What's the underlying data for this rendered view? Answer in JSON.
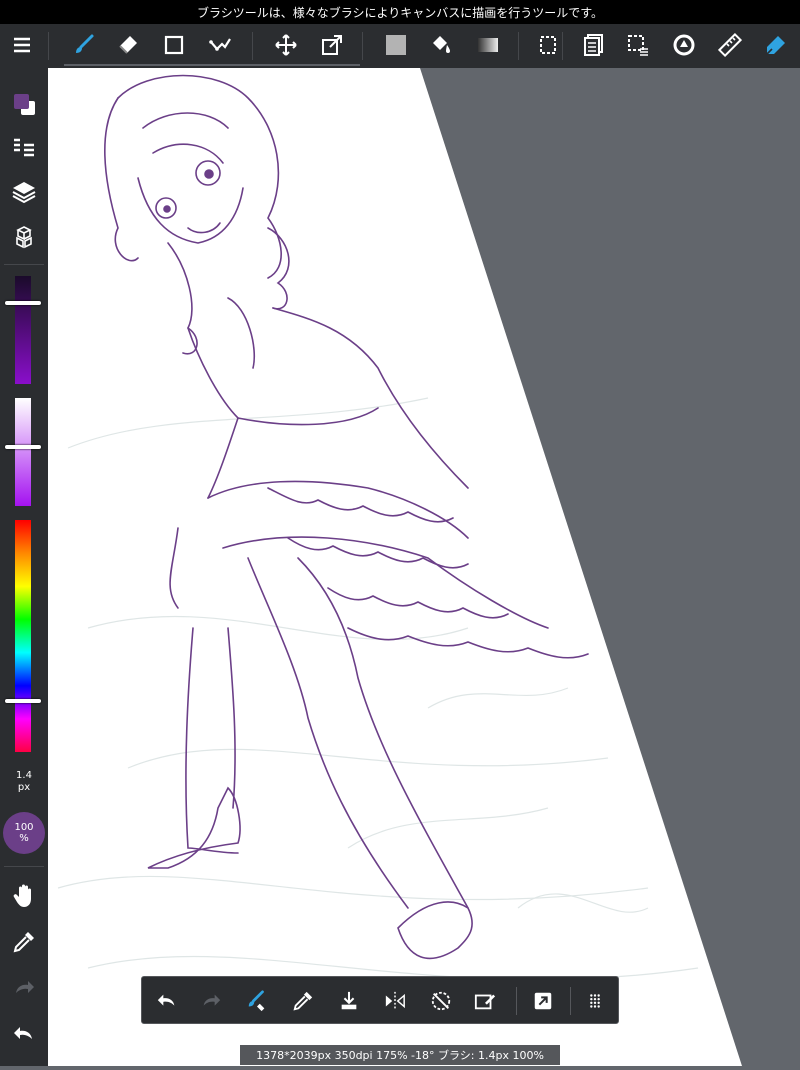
{
  "hint": "ブラシツールは、様々なブラシによりキャンバスに描画を行うツールです。",
  "top_toolbar": {
    "tools": [
      {
        "name": "menu-icon"
      },
      {
        "name": "brush-icon",
        "active": true
      },
      {
        "name": "eraser-icon"
      },
      {
        "name": "shape-icon"
      },
      {
        "name": "correction-icon"
      },
      {
        "name": "move-icon"
      },
      {
        "name": "transform-icon"
      },
      {
        "name": "fill-icon"
      },
      {
        "name": "bucket-icon"
      },
      {
        "name": "gradient-icon"
      },
      {
        "name": "select-icon"
      },
      {
        "name": "filter-icon"
      },
      {
        "name": "select-option-icon"
      },
      {
        "name": "rotate-icon"
      },
      {
        "name": "ruler-icon"
      },
      {
        "name": "pen-icon"
      }
    ]
  },
  "left_toolbar": {
    "foreground_color": "#6b3f88",
    "background_color": "#ffffff",
    "brush_size_value": "1.4",
    "brush_size_unit": "px",
    "opacity_value": "100",
    "opacity_unit": "%",
    "hsv_slider_levels": [
      0.25,
      0.45,
      0.78
    ]
  },
  "bottom_toolbar": {
    "tools": [
      {
        "name": "undo-icon"
      },
      {
        "name": "redo-icon"
      },
      {
        "name": "eraser-toggle-icon"
      },
      {
        "name": "eyedropper-icon"
      },
      {
        "name": "save-icon"
      },
      {
        "name": "flip-icon"
      },
      {
        "name": "rotate-reset-icon"
      },
      {
        "name": "clear-icon"
      },
      {
        "name": "fullscreen-icon"
      },
      {
        "name": "more-icon"
      }
    ]
  },
  "status": "1378*2039px 350dpi 175% -18° ブラシ: 1.4px 100%",
  "colors": {
    "toolbar": "#2b2d30",
    "accent": "#2fa3e0",
    "canvas": "#ffffff",
    "outside": "#62666c",
    "line_art": "#6b3f88"
  }
}
